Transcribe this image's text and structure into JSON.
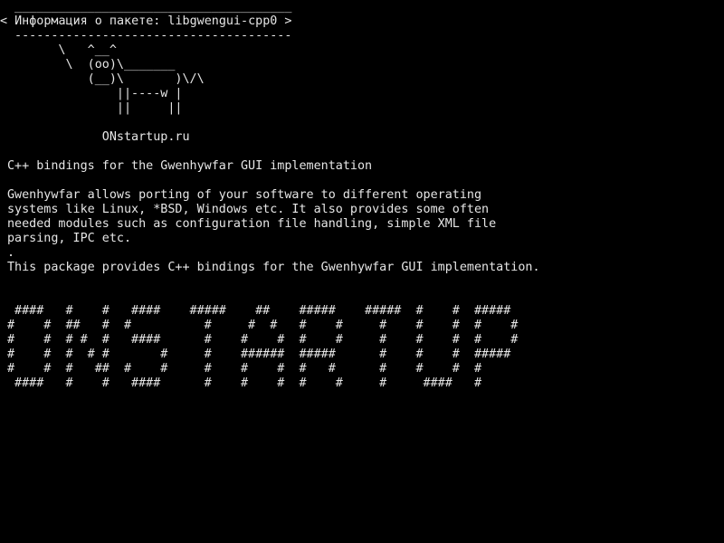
{
  "cowsay": {
    "top_border": " ______________________________________",
    "title_line": "< Информация о пакете: libgwengui-cpp0 >",
    "bottom_border": " --------------------------------------",
    "cow": [
      "       \\   ^__^",
      "        \\  (oo)\\_______",
      "           (__)\\       )\\/\\",
      "               ||----w |",
      "               ||     ||",
      "",
      "             ONstartup.ru"
    ]
  },
  "description": {
    "lines": [
      "C++ bindings for the Gwenhywfar GUI implementation",
      "",
      "Gwenhywfar allows porting of your software to different operating",
      "systems like Linux, *BSD, Windows etc. It also provides some often",
      "needed modules such as configuration file handling, simple XML file",
      "parsing, IPC etc.",
      ".",
      "This package provides C++ bindings for the Gwenhywfar GUI implementation."
    ]
  },
  "banner": {
    "lines": [
      " ####   #    #   ####    #####    ##    #####    #####  #    #  #####",
      "#    #  ##   #  #          #     #  #   #    #     #    #    #  #    #",
      "#    #  # #  #   ####      #    #    #  #    #     #    #    #  #    #",
      "#    #  #  # #       #     #    ######  #####      #    #    #  #####",
      "#    #  #   ##  #    #     #    #    #  #   #      #    #    #  #",
      " ####   #    #   ####      #    #    #  #    #     #     ####   #"
    ]
  }
}
